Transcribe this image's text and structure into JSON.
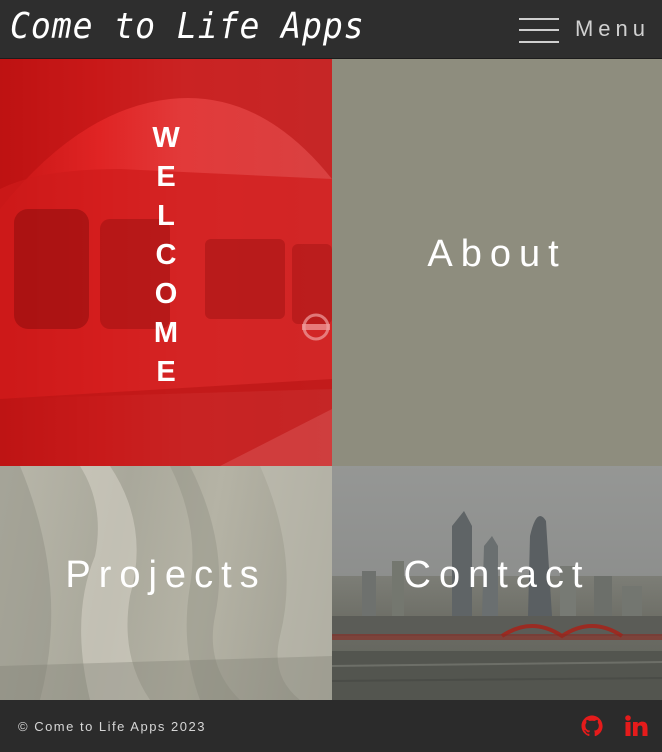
{
  "header": {
    "brand": "Come to Life Apps",
    "menu_label": "Menu"
  },
  "tiles": {
    "welcome_letters": [
      "W",
      "E",
      "L",
      "C",
      "O",
      "M",
      "E"
    ],
    "about": "About",
    "projects": "Projects",
    "contact": "Contact"
  },
  "footer": {
    "copyright": "© Come to Life Apps 2023",
    "social_icons": [
      "github-icon",
      "linkedin-icon"
    ]
  },
  "colors": {
    "header_bg": "#2e2e2e",
    "welcome_red": "#e02424",
    "about_bg": "#8e8d7e",
    "social_red": "#e51b1b"
  }
}
